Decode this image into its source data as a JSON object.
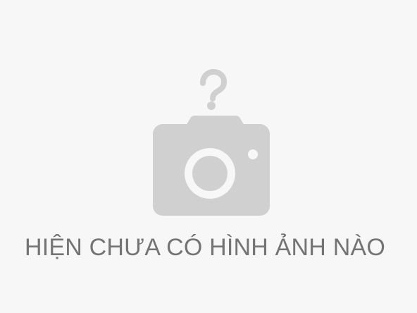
{
  "placeholder": {
    "icon": "camera-question-icon",
    "message": "HIỆN CHƯA CÓ HÌNH ẢNH NÀO",
    "colors": {
      "background": "#f7f7f7",
      "icon": "#d0d0d0",
      "text": "#747474"
    }
  }
}
